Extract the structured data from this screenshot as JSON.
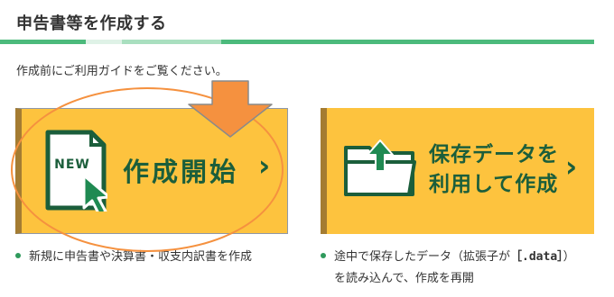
{
  "section": {
    "heading": "申告書等を作成する",
    "intro": "作成前にご利用ガイドをご覧ください。"
  },
  "cards": {
    "create": {
      "badge": "NEW",
      "label": "作成開始",
      "chevron": "›",
      "icon": "new-document-icon"
    },
    "reuse": {
      "line1": "保存データを",
      "line2": "利用して作成",
      "chevron": "›",
      "icon": "folder-upload-icon"
    }
  },
  "notes": {
    "create": "新規に申告書や決算書・収支内訳書を作成",
    "reuse_pre": "途中で保存したデータ（拡張子が",
    "reuse_code": "［.data］",
    "reuse_post": "）",
    "reuse_line2": "を読み込んで、作成を再開"
  },
  "colors": {
    "green_dark": "#1b5e3b",
    "green_rule": "#4cba7c",
    "card_yellow": "#fdc33e",
    "card_edge": "#a47c32",
    "highlight_orange": "#f5913f"
  }
}
